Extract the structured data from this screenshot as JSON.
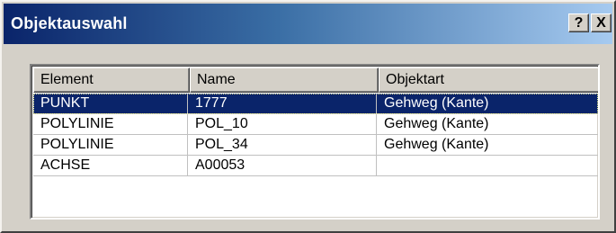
{
  "window": {
    "title": "Objektauswahl",
    "help_label": "?",
    "close_label": "X"
  },
  "list": {
    "columns": [
      "Element",
      "Name",
      "Objektart"
    ],
    "rows": [
      {
        "element": "PUNKT",
        "name": "1777",
        "objektart": "Gehweg (Kante)",
        "selected": true
      },
      {
        "element": "POLYLINIE",
        "name": "POL_10",
        "objektart": "Gehweg (Kante)",
        "selected": false
      },
      {
        "element": "POLYLINIE",
        "name": "POL_34",
        "objektart": "Gehweg (Kante)",
        "selected": false
      },
      {
        "element": "ACHSE",
        "name": "A00053",
        "objektart": "",
        "selected": false
      }
    ]
  },
  "colors": {
    "selection": "#0a246a",
    "titlebar_start": "#0a246a",
    "titlebar_end": "#a6caf0",
    "face": "#d4d0c8"
  }
}
